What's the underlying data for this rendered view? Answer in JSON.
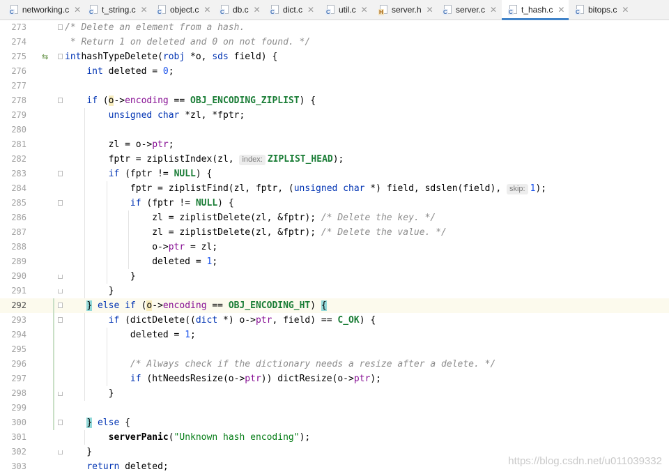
{
  "tabs": [
    {
      "label": "networking.c",
      "icon": "c-file-icon",
      "type": "c",
      "width": 118
    },
    {
      "label": "t_string.c",
      "icon": "c-file-icon",
      "type": "c",
      "width": 98
    },
    {
      "label": "object.c",
      "icon": "c-file-icon",
      "type": "c",
      "width": 90
    },
    {
      "label": "db.c",
      "icon": "c-file-icon",
      "type": "c",
      "width": 72
    },
    {
      "label": "dict.c",
      "icon": "c-file-icon",
      "type": "c",
      "width": 80
    },
    {
      "label": "util.c",
      "icon": "c-file-icon",
      "type": "c",
      "width": 76
    },
    {
      "label": "server.h",
      "icon": "h-file-icon",
      "type": "h",
      "width": 92
    },
    {
      "label": "server.c",
      "icon": "c-file-icon",
      "type": "c",
      "width": 94
    },
    {
      "label": "t_hash.c",
      "icon": "c-file-icon",
      "type": "c",
      "width": 96,
      "active": true
    },
    {
      "label": "bitops.c",
      "icon": "c-file-icon",
      "type": "c",
      "width": 90
    }
  ],
  "editor": {
    "current_line": 292,
    "lines": [
      {
        "n": "273",
        "fold": "start",
        "tokens": [
          [
            "cmt",
            "/* Delete an element from a hash."
          ]
        ]
      },
      {
        "n": "274",
        "tokens": [
          [
            "cmt",
            " * Return 1 on deleted and 0 on not found. */"
          ]
        ]
      },
      {
        "n": "275",
        "fold": "start",
        "marker": "⇆",
        "tokens": [
          [
            "kw",
            "int"
          ],
          [
            "",
            "hashTypeDelete("
          ],
          [
            "kw",
            "robj"
          ],
          [
            "",
            " *o, "
          ],
          [
            "kw",
            "sds"
          ],
          [
            "",
            " field) {"
          ]
        ]
      },
      {
        "n": "276",
        "tokens": [
          [
            "",
            "    "
          ],
          [
            "kw",
            "int"
          ],
          [
            "",
            " deleted = "
          ],
          [
            "num",
            "0"
          ],
          [
            "",
            ";"
          ]
        ]
      },
      {
        "n": "277",
        "tokens": []
      },
      {
        "n": "278",
        "fold": "start",
        "tokens": [
          [
            "",
            "    "
          ],
          [
            "kw",
            "if"
          ],
          [
            "",
            " ("
          ],
          [
            "varhl",
            "o"
          ],
          [
            "",
            "->"
          ],
          [
            "fld",
            "encoding"
          ],
          [
            "",
            " == "
          ],
          [
            "mac",
            "OBJ_ENCODING_ZIPLIST"
          ],
          [
            "",
            ") {"
          ]
        ]
      },
      {
        "n": "279",
        "tokens": [
          [
            "",
            "        "
          ],
          [
            "kw",
            "unsigned char"
          ],
          [
            "",
            " *zl, *fptr;"
          ]
        ]
      },
      {
        "n": "280",
        "tokens": []
      },
      {
        "n": "281",
        "tokens": [
          [
            "",
            "        zl = o->"
          ],
          [
            "fld",
            "ptr"
          ],
          [
            "",
            ";"
          ]
        ]
      },
      {
        "n": "282",
        "tokens": [
          [
            "",
            "        fptr = ziplistIndex(zl, "
          ],
          [
            "hint",
            "index:"
          ],
          [
            "mac",
            "ZIPLIST_HEAD"
          ],
          [
            "",
            ");"
          ]
        ]
      },
      {
        "n": "283",
        "fold": "start",
        "tokens": [
          [
            "",
            "        "
          ],
          [
            "kw",
            "if"
          ],
          [
            "",
            " (fptr != "
          ],
          [
            "mac",
            "NULL"
          ],
          [
            "",
            ") {"
          ]
        ]
      },
      {
        "n": "284",
        "tokens": [
          [
            "",
            "            fptr = ziplistFind(zl, fptr, ("
          ],
          [
            "kw",
            "unsigned char"
          ],
          [
            "",
            " *) field, sdslen(field), "
          ],
          [
            "hint",
            "skip:"
          ],
          [
            "num",
            "1"
          ],
          [
            "",
            ");"
          ]
        ]
      },
      {
        "n": "285",
        "fold": "start",
        "tokens": [
          [
            "",
            "            "
          ],
          [
            "kw",
            "if"
          ],
          [
            "",
            " (fptr != "
          ],
          [
            "mac",
            "NULL"
          ],
          [
            "",
            ") {"
          ]
        ]
      },
      {
        "n": "286",
        "tokens": [
          [
            "",
            "                zl = ziplistDelete(zl, &fptr); "
          ],
          [
            "cmt",
            "/* Delete the key. */"
          ]
        ]
      },
      {
        "n": "287",
        "tokens": [
          [
            "",
            "                zl = ziplistDelete(zl, &fptr); "
          ],
          [
            "cmt",
            "/* Delete the value. */"
          ]
        ]
      },
      {
        "n": "288",
        "tokens": [
          [
            "",
            "                o->"
          ],
          [
            "fld",
            "ptr"
          ],
          [
            "",
            " = zl;"
          ]
        ]
      },
      {
        "n": "289",
        "tokens": [
          [
            "",
            "                deleted = "
          ],
          [
            "num",
            "1"
          ],
          [
            "",
            ";"
          ]
        ]
      },
      {
        "n": "290",
        "fold": "end",
        "tokens": [
          [
            "",
            "            }"
          ]
        ]
      },
      {
        "n": "291",
        "fold": "end",
        "tokens": [
          [
            "",
            "        }"
          ]
        ]
      },
      {
        "n": "292",
        "fold": "start",
        "tokens": [
          [
            "",
            "    "
          ],
          [
            "bracehl",
            "}"
          ],
          [
            "",
            " "
          ],
          [
            "kw",
            "else if"
          ],
          [
            "",
            " ("
          ],
          [
            "varhl",
            "o"
          ],
          [
            "",
            "->"
          ],
          [
            "fld",
            "encoding"
          ],
          [
            "",
            " == "
          ],
          [
            "mac",
            "OBJ_ENCODING_HT"
          ],
          [
            "",
            ") "
          ],
          [
            "bracehl",
            "{"
          ]
        ]
      },
      {
        "n": "293",
        "fold": "start",
        "tokens": [
          [
            "",
            "        "
          ],
          [
            "kw",
            "if"
          ],
          [
            "",
            " (dictDelete(("
          ],
          [
            "kw",
            "dict"
          ],
          [
            "",
            " *) o->"
          ],
          [
            "fld",
            "ptr"
          ],
          [
            "",
            ", field) == "
          ],
          [
            "mac",
            "C_OK"
          ],
          [
            "",
            ") {"
          ]
        ]
      },
      {
        "n": "294",
        "tokens": [
          [
            "",
            "            deleted = "
          ],
          [
            "num",
            "1"
          ],
          [
            "",
            ";"
          ]
        ]
      },
      {
        "n": "295",
        "tokens": []
      },
      {
        "n": "296",
        "tokens": [
          [
            "",
            "            "
          ],
          [
            "cmt",
            "/* Always check if the dictionary needs a resize after a delete. */"
          ]
        ]
      },
      {
        "n": "297",
        "tokens": [
          [
            "",
            "            "
          ],
          [
            "kw",
            "if"
          ],
          [
            "",
            " (htNeedsResize(o->"
          ],
          [
            "fld",
            "ptr"
          ],
          [
            "",
            ")) dictResize(o->"
          ],
          [
            "fld",
            "ptr"
          ],
          [
            "",
            ");"
          ]
        ]
      },
      {
        "n": "298",
        "fold": "end",
        "tokens": [
          [
            "",
            "        }"
          ]
        ]
      },
      {
        "n": "299",
        "tokens": []
      },
      {
        "n": "300",
        "fold": "start",
        "tokens": [
          [
            "",
            "    "
          ],
          [
            "bracehl",
            "}"
          ],
          [
            "",
            " "
          ],
          [
            "kw",
            "else"
          ],
          [
            "",
            " {"
          ]
        ]
      },
      {
        "n": "301",
        "tokens": [
          [
            "",
            "        "
          ],
          [
            "fnb",
            "serverPanic"
          ],
          [
            "",
            "("
          ],
          [
            "str",
            "\"Unknown hash encoding\""
          ],
          [
            "",
            ");"
          ]
        ]
      },
      {
        "n": "302",
        "fold": "end",
        "tokens": [
          [
            "",
            "    }"
          ]
        ]
      },
      {
        "n": "303",
        "tokens": [
          [
            "",
            "    "
          ],
          [
            "kw",
            "return"
          ],
          [
            "",
            " deleted;"
          ]
        ]
      }
    ]
  },
  "watermark": "https://blog.csdn.net/u011039332"
}
